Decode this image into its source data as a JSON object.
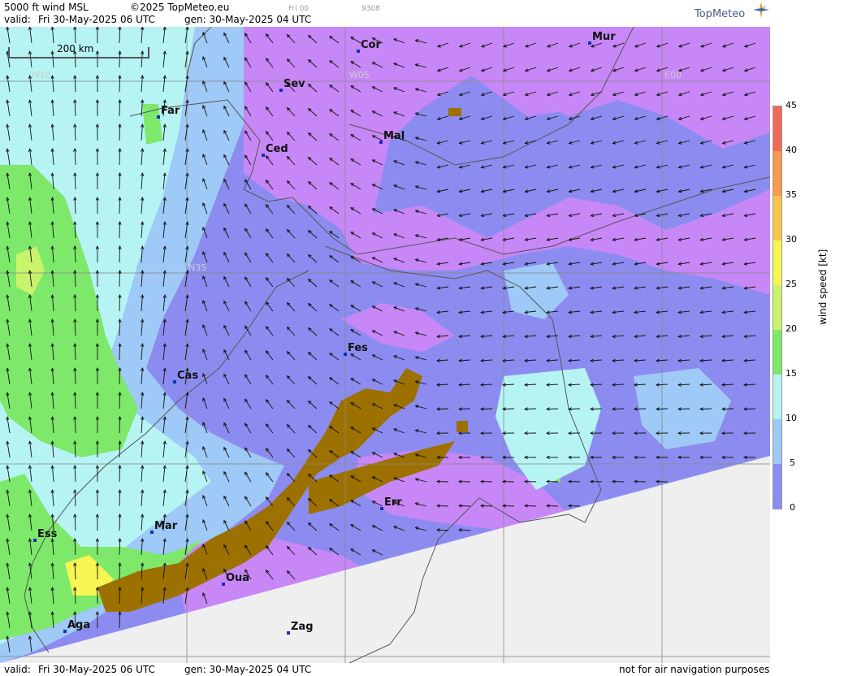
{
  "header": {
    "product": "5000 ft wind MSL",
    "copyright": "©2025 TopMeteo.eu",
    "valid_label": "valid:",
    "valid_time": "Fri  30-May-2025  06 UTC",
    "gen_time": "gen: 30-May-2025 04 UTC",
    "run_small": "Fri 00",
    "code_small": "9308",
    "logo": "TopMeteo"
  },
  "footer": {
    "valid_label": "valid:",
    "valid_time": "Fri  30-May-2025  06 UTC",
    "gen_time": "gen: 30-May-2025 04 UTC",
    "disclaimer": "not for air navigation purposes"
  },
  "map": {
    "scale_label": "200 km",
    "grid_labels": [
      "W10",
      "W05",
      "E00",
      "N35"
    ],
    "cities": [
      "Cor",
      "Mur",
      "Sev",
      "Far",
      "Mal",
      "Ced",
      "Fes",
      "Cas",
      "Err",
      "Mar",
      "Ess",
      "Oua",
      "Aga",
      "Zag"
    ]
  },
  "legend": {
    "title": "wind speed [kt]",
    "ticks": [
      "45",
      "40",
      "35",
      "30",
      "25",
      "20",
      "15",
      "10",
      "5",
      "0"
    ],
    "colors": [
      "#ef6a57",
      "#f59a4e",
      "#f8c44c",
      "#f6f553",
      "#c8f36a",
      "#7ee86b",
      "#b6f4f4",
      "#9fc9f6",
      "#8c8cf0",
      "#c887f6"
    ]
  },
  "colors": {
    "high_terrain": "#9c7100",
    "no_data": "#efefef",
    "calm": "#c887f6",
    "light": "#8c8cf0",
    "moderate": "#9fc9f6",
    "fresh": "#b6f4f4",
    "strong": "#7ee86b"
  }
}
